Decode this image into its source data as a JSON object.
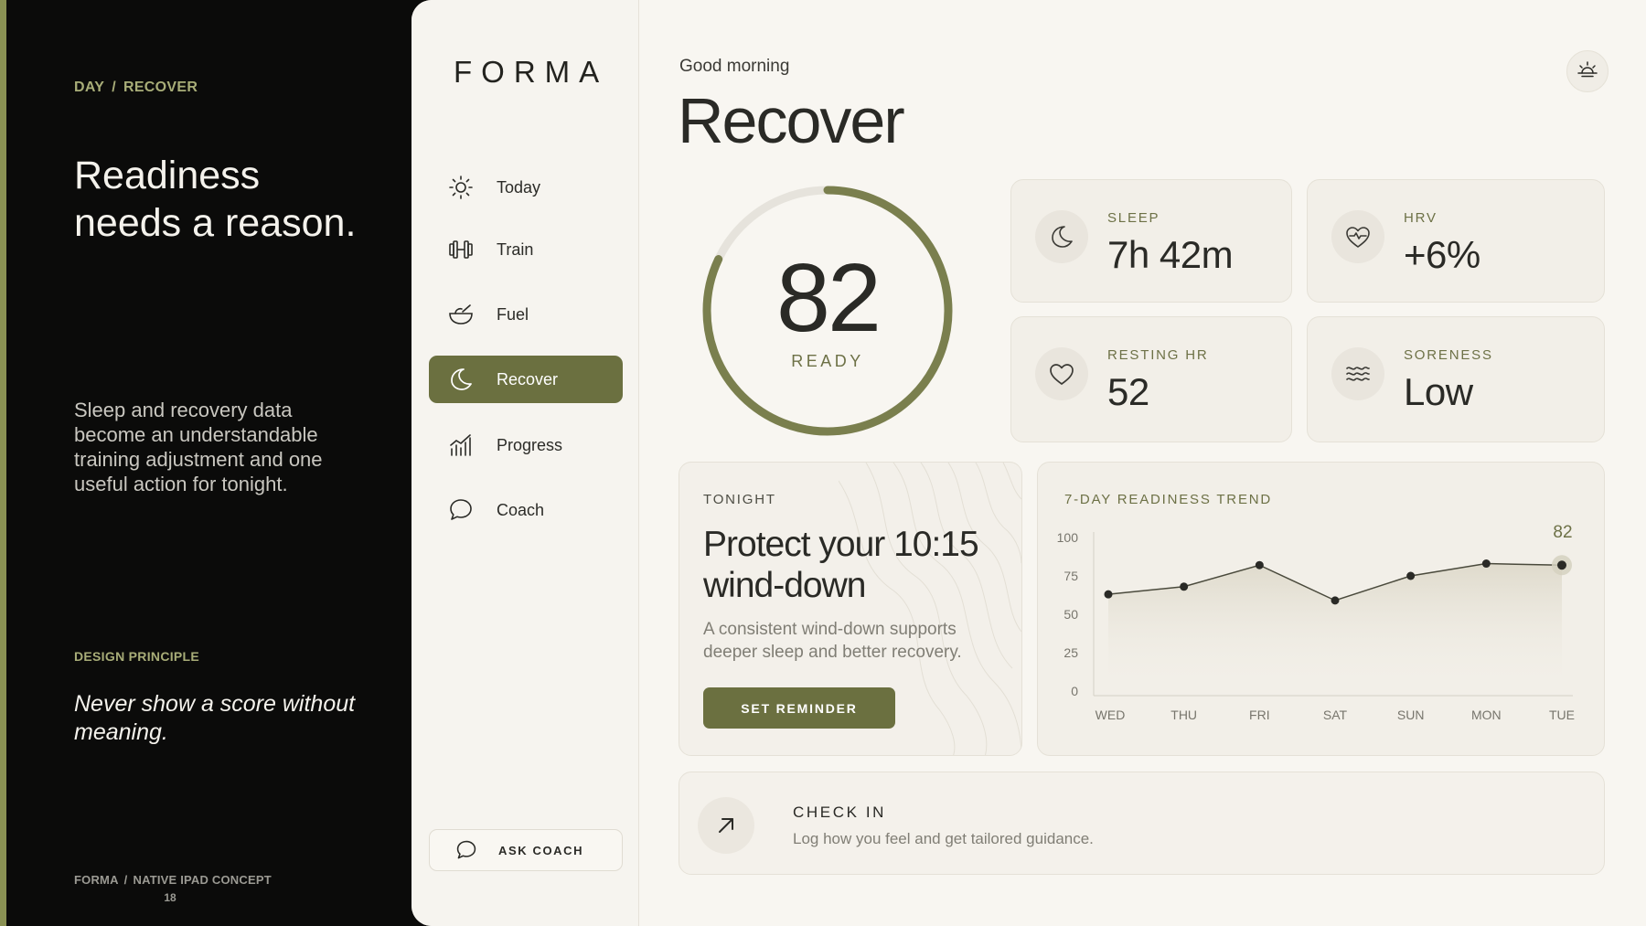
{
  "left": {
    "crumb_1": "DAY",
    "crumb_sep": "/",
    "crumb_2": "RECOVER",
    "headline": "Readiness needs a reason.",
    "description": "Sleep and recovery data become an understandable training adjustment and one useful action for tonight.",
    "principle_label": "DESIGN PRINCIPLE",
    "principle": "Never show a score without meaning.",
    "footer_brand": "FORMA",
    "footer_sep": "/",
    "footer_concept": "NATIVE IPAD CONCEPT",
    "page_number": "18"
  },
  "sidebar": {
    "brand": "FORMA",
    "items": [
      {
        "label": "Today",
        "icon": "sun-icon"
      },
      {
        "label": "Train",
        "icon": "dumbbell-icon"
      },
      {
        "label": "Fuel",
        "icon": "bowl-icon"
      },
      {
        "label": "Recover",
        "icon": "moon-icon",
        "active": true
      },
      {
        "label": "Progress",
        "icon": "bar-chart-icon"
      },
      {
        "label": "Coach",
        "icon": "chat-bubble-icon"
      }
    ],
    "ask_coach": "ASK COACH"
  },
  "header": {
    "greeting": "Good morning",
    "title": "Recover",
    "theme_icon": "sunrise-icon"
  },
  "readiness": {
    "score": "82",
    "label": "READY",
    "fraction": 0.82
  },
  "metrics": {
    "sleep": {
      "label": "SLEEP",
      "value": "7h 42m",
      "icon": "moon-icon"
    },
    "hrv": {
      "label": "HRV",
      "value": "+6%",
      "icon": "heart-pulse-icon"
    },
    "resting_hr": {
      "label": "RESTING HR",
      "value": "52",
      "icon": "heart-icon"
    },
    "soreness": {
      "label": "SORENESS",
      "value": "Low",
      "icon": "waves-icon"
    }
  },
  "tonight": {
    "label": "TONIGHT",
    "title": "Protect your 10:15 wind-down",
    "body": "A consistent wind-down supports deeper sleep and better recovery.",
    "button": "SET REMINDER"
  },
  "trend": {
    "label": "7-DAY READINESS TREND",
    "last_value_label": "82"
  },
  "chart_data": {
    "type": "area",
    "title": "7-DAY READINESS TREND",
    "categories": [
      "WED",
      "THU",
      "FRI",
      "SAT",
      "SUN",
      "MON",
      "TUE"
    ],
    "values": [
      63,
      68,
      82,
      59,
      75,
      83,
      82
    ],
    "y_ticks": [
      0,
      25,
      50,
      75,
      100
    ],
    "ylim": [
      0,
      100
    ],
    "grid": false,
    "line_color": "#4a4a3c",
    "highlight_last": true
  },
  "checkin": {
    "title": "CHECK IN",
    "body": "Log how you feel and get tailored guidance.",
    "icon": "arrow-up-right-icon"
  },
  "colors": {
    "accent": "#6b7040",
    "accent_light": "#a8ad78",
    "background": "#f8f6f1",
    "dark_panel": "#0b0b0a"
  }
}
